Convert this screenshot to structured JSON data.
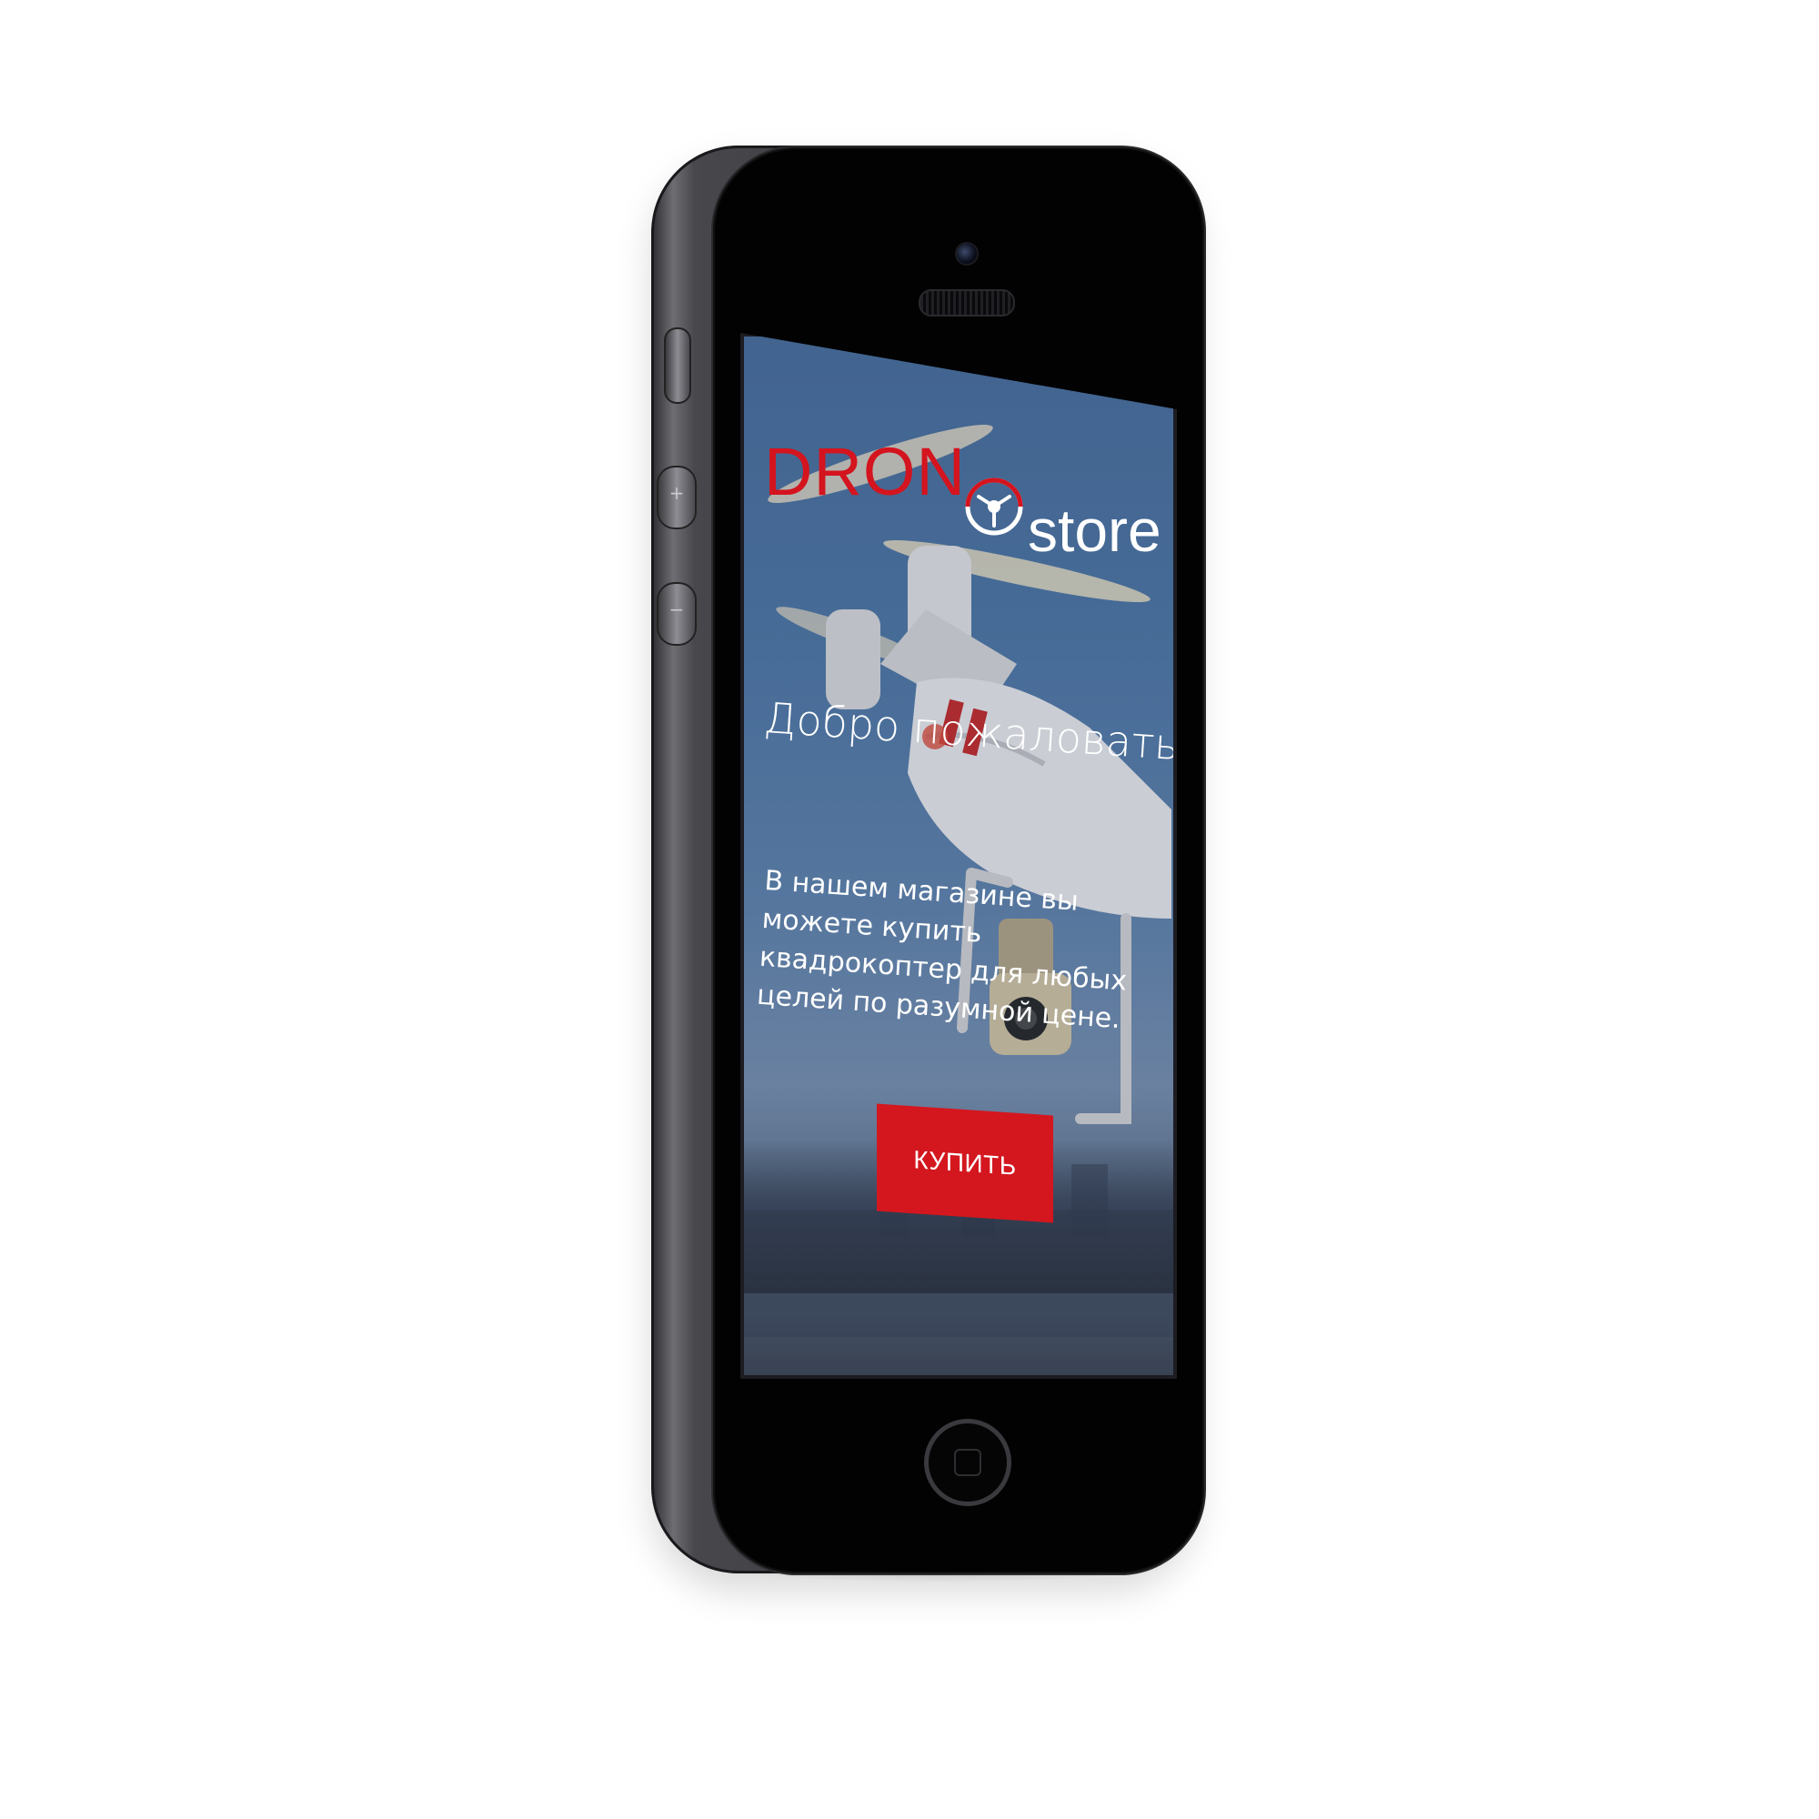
{
  "brand": {
    "name_part1": "DRON",
    "name_part2": "store",
    "accent_color": "#d4141e"
  },
  "hero": {
    "welcome": "Добро пожаловать!",
    "description": "В нашем магазине вы можете купить квадрокоптер для любых целей по разумной цене."
  },
  "cta": {
    "buy_label": "КУПИТЬ",
    "button_color": "#d4171f"
  },
  "device": {
    "side_buttons": [
      "mute-switch",
      "volume-up",
      "volume-down"
    ],
    "icons": [
      "camera-icon",
      "speaker-grille-icon",
      "home-button-icon",
      "plus-icon",
      "minus-icon"
    ]
  },
  "volume_signs": {
    "up": "+",
    "down": "−"
  }
}
